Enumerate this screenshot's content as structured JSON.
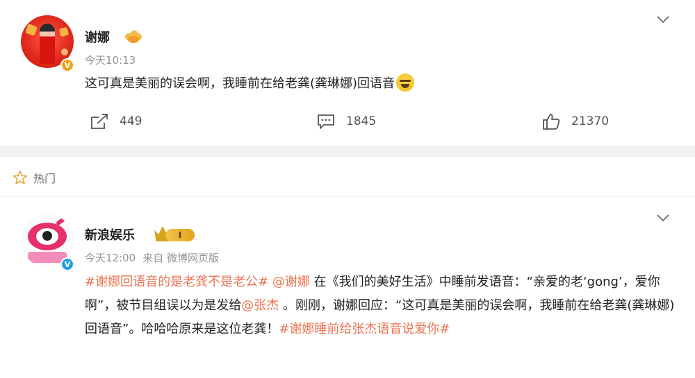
{
  "post": {
    "author": "谢娜",
    "time": "今天10:13",
    "content": "这可真是美丽的误会啊，我睡前在给老龚(龚琳娜)回语音",
    "repost_count": "449",
    "comment_count": "1845",
    "like_count": "21370",
    "verified_badge": "V"
  },
  "hot_section": {
    "label": "热门"
  },
  "hot_comment": {
    "author": "新浪娱乐",
    "level_badge": "I",
    "time": "今天12:00",
    "source": "来自 微博网页版",
    "verified_badge": "V",
    "content": {
      "tag1": "#谢娜回语音的是老龚不是老公#",
      "mention1": "@谢娜",
      "text1": " 在《我们的美好生活》中睡前发语音：“亲爱的老‘gong’，爱你啊”，被节目组误以为是发给",
      "mention2": "@张杰",
      "text2": " 。刚刚，谢娜回应：“这可真是美丽的误会啊，我睡前在给老龚(龚琳娜)回语音”。哈哈哈原来是这位老龚！",
      "tag2": "#谢娜睡前给张杰语音说爱你#"
    }
  },
  "icons": {
    "repost": "repost-icon",
    "comment": "comment-icon",
    "like": "like-icon",
    "star": "star-icon",
    "chevron": "chevron-down-icon"
  },
  "colors": {
    "highlight": "#eb7350",
    "muted": "#939393",
    "verified_gold": "#f3a21b",
    "verified_blue": "#1ea0ea"
  }
}
